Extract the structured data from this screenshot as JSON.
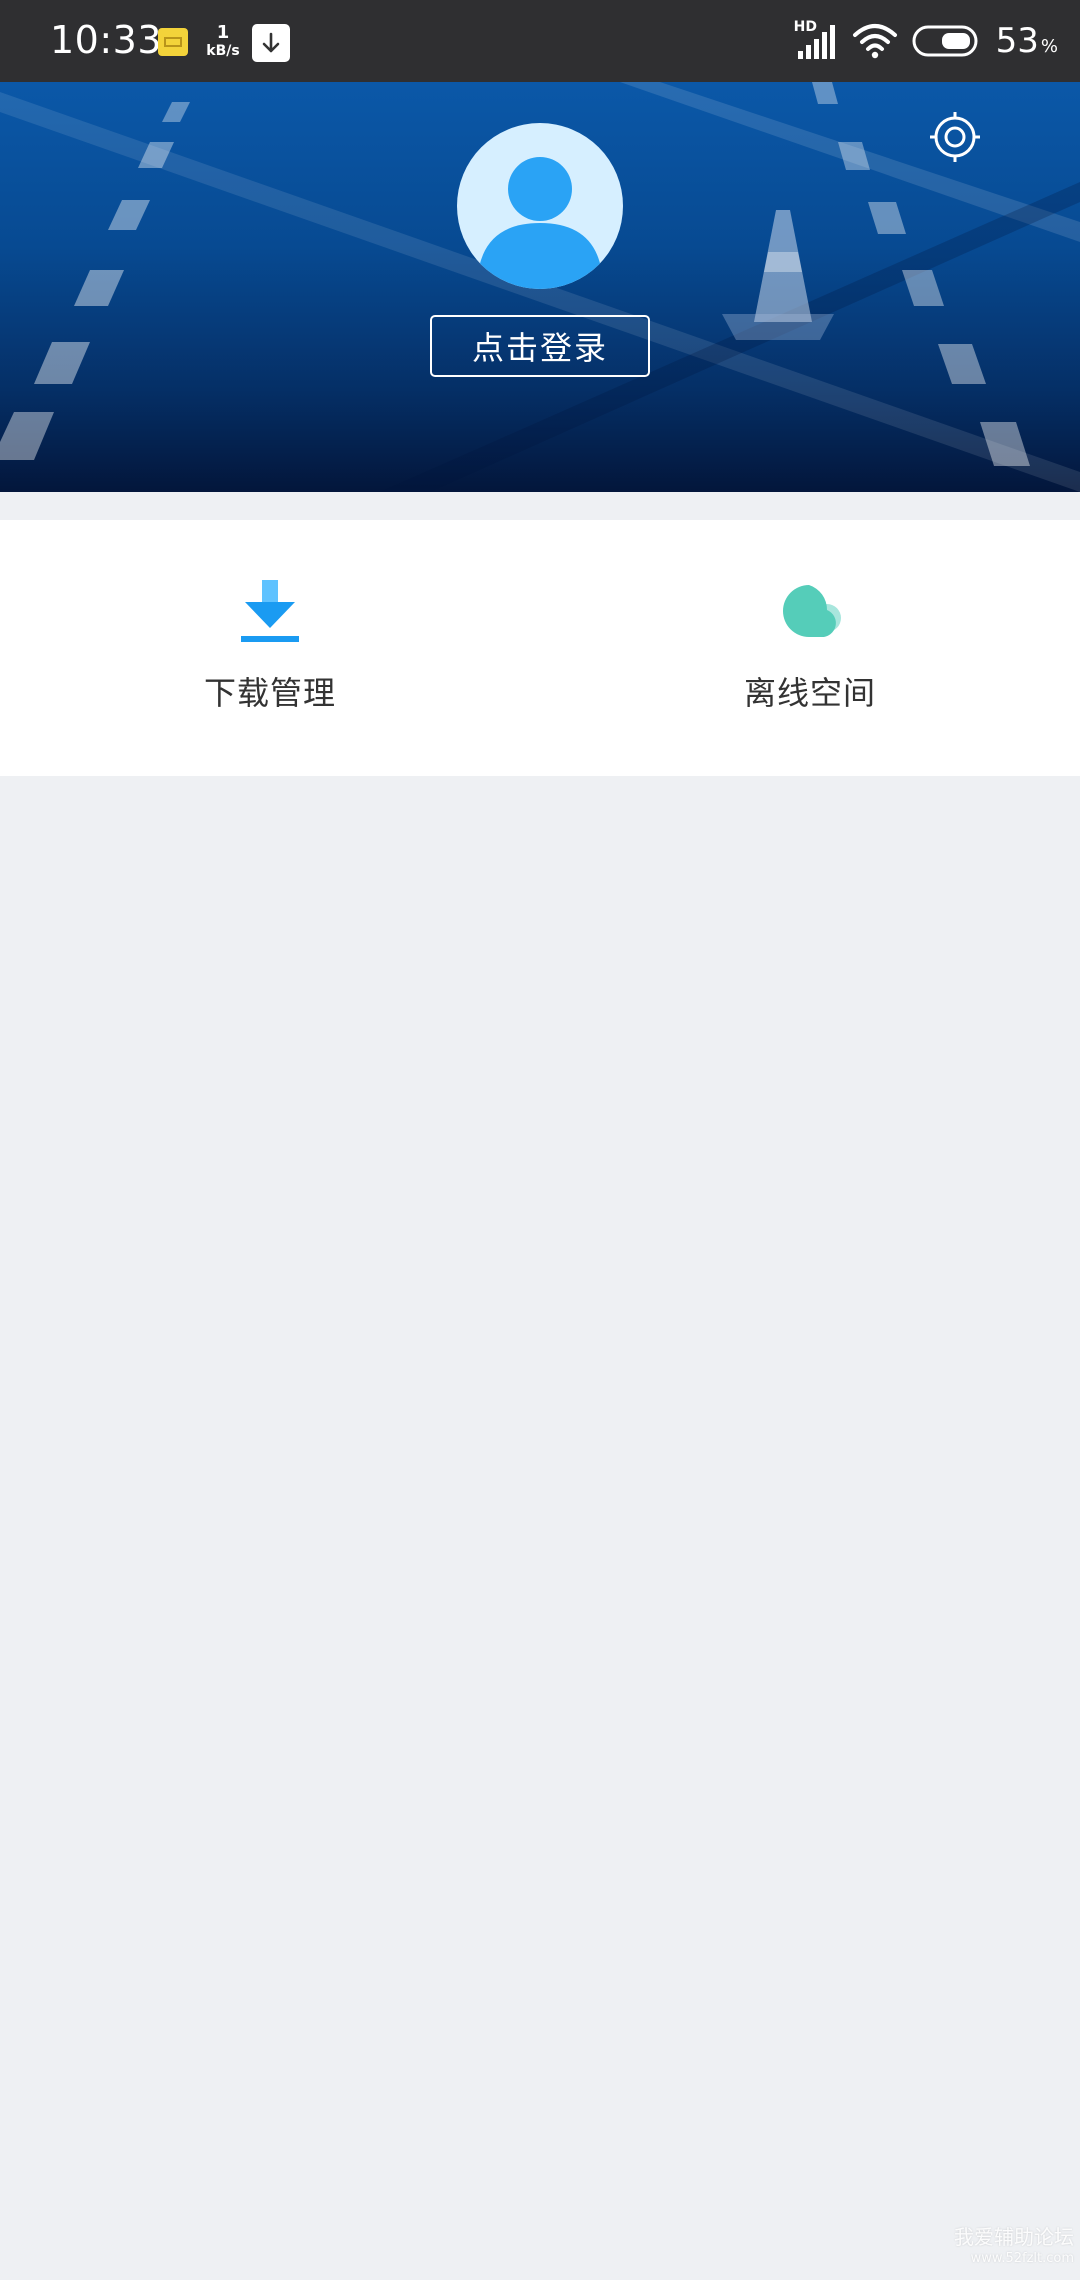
{
  "status_bar": {
    "time": "10:33",
    "net_speed_value": "1",
    "net_speed_unit": "kB/s",
    "signal_label": "HD",
    "battery_percent": "53",
    "battery_unit": "%"
  },
  "header": {
    "login_label": "点击登录"
  },
  "menu": {
    "items": [
      {
        "label": "下载管理",
        "icon": "download-icon",
        "color": "#1a9bf2"
      },
      {
        "label": "离线空间",
        "icon": "cloud-icon",
        "color": "#55cdb9"
      }
    ]
  },
  "watermark": {
    "text": "我爱辅助论坛",
    "url": "www.52fzlt.com"
  }
}
